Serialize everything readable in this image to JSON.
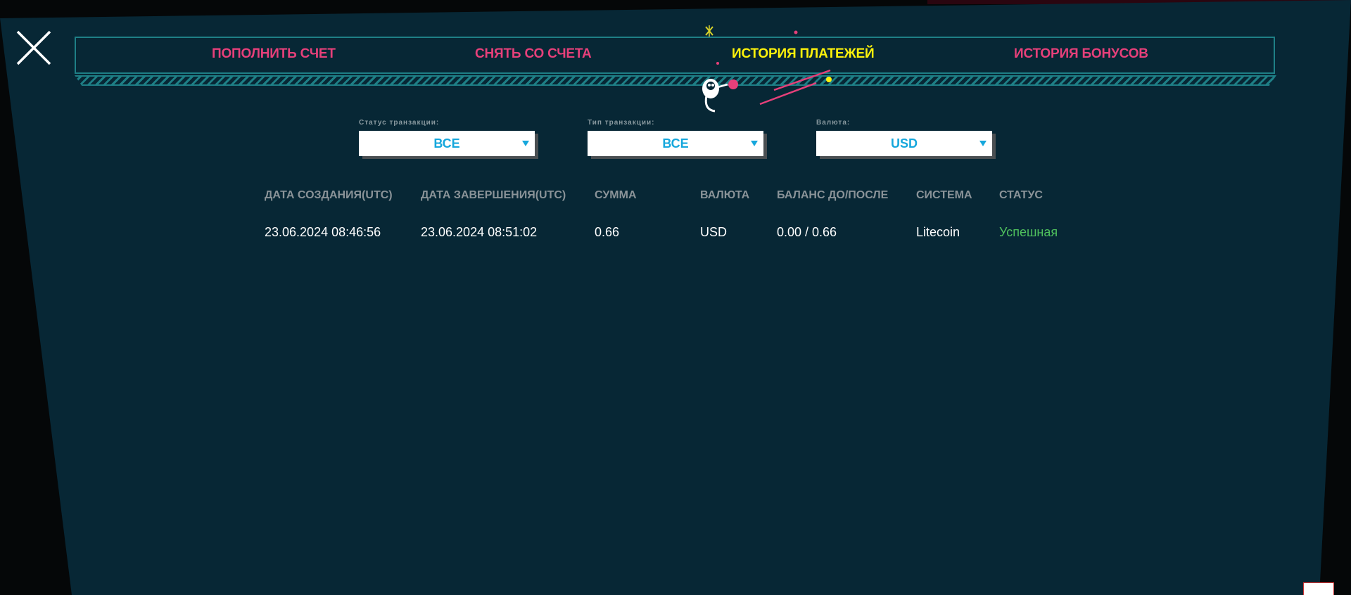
{
  "tabs": [
    {
      "label": "ПОПОЛНИТЬ СЧЕТ",
      "active": false
    },
    {
      "label": "СНЯТЬ СО СЧЕТА",
      "active": false
    },
    {
      "label": "ИСТОРИЯ ПЛАТЕЖЕЙ",
      "active": true
    },
    {
      "label": "ИСТОРИЯ БОНУСОВ",
      "active": false
    }
  ],
  "filters": [
    {
      "label": "Статус транзакции:",
      "value": "ВСЕ"
    },
    {
      "label": "Тип транзакции:",
      "value": "ВСЕ"
    },
    {
      "label": "Валюта:",
      "value": "USD"
    }
  ],
  "table": {
    "headers": [
      "ДАТА СОЗДАНИЯ(UTC)",
      "ДАТА ЗАВЕРШЕНИЯ(UTC)",
      "СУММА",
      "ВАЛЮТА",
      "БАЛАНС ДО/ПОСЛЕ",
      "СИСТЕМА",
      "СТАТУС"
    ],
    "rows": [
      [
        "23.06.2024 08:46:56",
        "23.06.2024 08:51:02",
        "0.66",
        "USD",
        "0.00 / 0.66",
        "Litecoin",
        "Успешная"
      ]
    ]
  },
  "icons": {
    "close": "close-icon",
    "dropdown": "chevron-down-icon",
    "mascot": "astronaut-mascot-icon"
  },
  "colors": {
    "background": "#072735",
    "tab_inactive": "#e6407a",
    "tab_active": "#fdf20b",
    "select_text": "#16a7dc",
    "status_success": "#4fc15d",
    "frame": "#1e7f86"
  }
}
